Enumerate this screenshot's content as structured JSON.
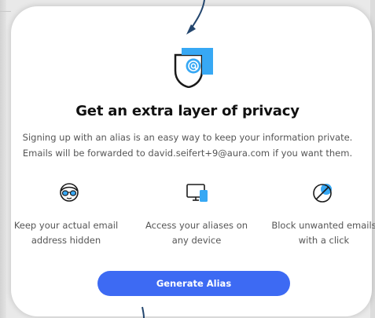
{
  "dialog": {
    "title": "Get an extra layer of privacy",
    "description_line1": "Signing up with an alias is an easy way to keep your information private.",
    "description_line2": "Emails will be forwarded to david.seifert+9@aura.com if you want them."
  },
  "features": [
    {
      "icon": "incognito-face-icon",
      "line1": "Keep your actual email",
      "line2": "address hidden"
    },
    {
      "icon": "devices-icon",
      "line1": "Access your aliases on",
      "line2": "any device"
    },
    {
      "icon": "block-icon",
      "line1": "Block unwanted emails",
      "line2": "with a click"
    }
  ],
  "cta": {
    "label": "Generate Alias"
  },
  "colors": {
    "accent": "#3d6af3",
    "icon_blue": "#37a8f4",
    "text_dark": "#111111",
    "text_muted": "#555555"
  }
}
